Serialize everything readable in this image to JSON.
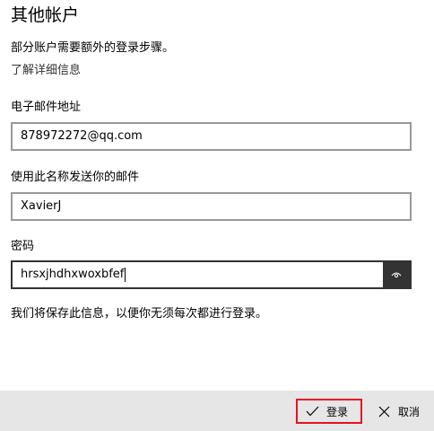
{
  "dialog": {
    "title": "其他帐户",
    "description": "部分账户需要额外的登录步骤。",
    "learn_more": "了解详细信息"
  },
  "fields": {
    "email": {
      "label": "电子邮件地址",
      "value": "878972272@qq.com"
    },
    "display_name": {
      "label": "使用此名称发送你的邮件",
      "value": "XavierJ"
    },
    "password": {
      "label": "密码",
      "value": "hrsxjhdhxwoxbfef",
      "reveal_icon": "eye-icon"
    }
  },
  "note": "我们将保存此信息，以便你无须每次都进行登录。",
  "footer": {
    "login_label": "登录",
    "login_icon": "checkmark-icon",
    "cancel_label": "取消",
    "cancel_icon": "close-icon"
  },
  "colors": {
    "footer_bg": "#e6e6e6",
    "highlight_border": "#e81123",
    "reveal_button_bg": "#333333"
  }
}
